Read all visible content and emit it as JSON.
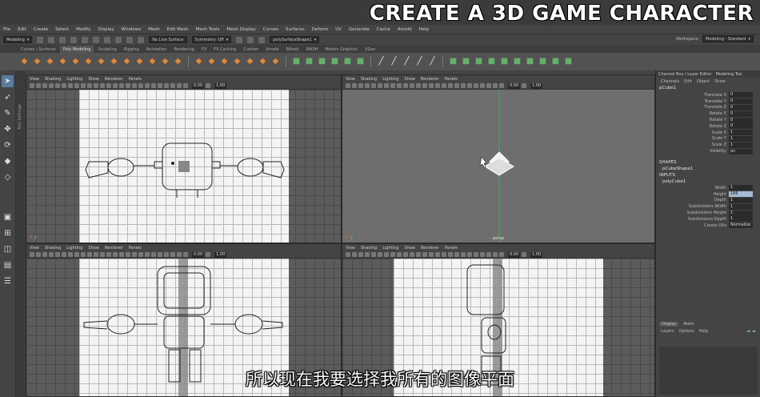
{
  "banner": "CREATE A 3D GAME CHARACTER",
  "subtitle": "所以现在我要选择我所有的图像平面",
  "menubar": [
    "File",
    "Edit",
    "Create",
    "Select",
    "Modify",
    "Display",
    "Windows",
    "Mesh",
    "Edit Mesh",
    "Mesh Tools",
    "Mesh Display",
    "Curves",
    "Surfaces",
    "Deform",
    "UV",
    "Generate",
    "Cache",
    "Arnold",
    "Help"
  ],
  "statusline": {
    "mode": "Modeling",
    "live_surface": "No Live Surface",
    "symmetry": "Symmetry: Off",
    "object": "polySurfaceShape1",
    "workspace_label": "Workspace:",
    "workspace_value": "Modeling - Standard"
  },
  "shelftabs": [
    "Curves / Surfaces",
    "Poly Modeling",
    "Sculpting",
    "Rigging",
    "Animation",
    "Rendering",
    "FX",
    "FX Caching",
    "Custom",
    "Arnold",
    "Bifrost",
    "MASH",
    "Motion Graphics",
    "XGen"
  ],
  "shelftab_active": 1,
  "shelf_groups": [
    {
      "color": "orange",
      "icons": [
        "sphere-icon",
        "cube-icon",
        "cylinder-icon",
        "cone-icon",
        "torus-icon",
        "plane-icon",
        "disc-icon",
        "platonic-icon",
        "pyramid-icon",
        "pipe-icon",
        "helix-icon",
        "gear-icon",
        "soccer-ball-icon"
      ]
    },
    {
      "color": "orange",
      "icons": [
        "svg-icon",
        "text-icon",
        "combine-icon",
        "separate-icon",
        "extract-icon",
        "smooth-icon",
        "boolean-icon"
      ]
    },
    {
      "color": "green",
      "icons": [
        "mirror-icon",
        "bridge-icon",
        "extrude-icon",
        "bevel-icon",
        "fill-hole-icon",
        "merge-icon"
      ]
    },
    {
      "color": "white",
      "icons": [
        "knife-icon",
        "multi-cut-icon",
        "target-weld-icon",
        "connect-icon",
        "edge-loop-icon"
      ]
    },
    {
      "color": "green",
      "icons": [
        "uv-editor-icon",
        "planar-map-icon",
        "auto-map-icon",
        "cylindrical-map-icon",
        "spherical-map-icon",
        "camera-map-icon",
        "layout-uv-icon",
        "unfold-icon",
        "cut-uv-icon",
        "sew-uv-icon"
      ]
    }
  ],
  "viewport_menu": [
    "View",
    "Shading",
    "Lighting",
    "Show",
    "Renderer",
    "Panels"
  ],
  "viewport_field_a": "0.00",
  "viewport_field_b": "1.00",
  "viewports": {
    "top_left": "front",
    "top_right": "persp",
    "bottom_left": "front",
    "bottom_right": "side"
  },
  "persp_label": "persp",
  "toolbox_label": "Tool Settings",
  "channel_box": {
    "tabs": [
      "Channel Box / Layer Editor",
      "Modeling Too"
    ],
    "menu": [
      "Channels",
      "Edit",
      "Object",
      "Show"
    ],
    "object_name": "pCube1",
    "transform_attrs": [
      {
        "label": "Translate X",
        "value": "0"
      },
      {
        "label": "Translate Y",
        "value": "0"
      },
      {
        "label": "Translate Z",
        "value": "0"
      },
      {
        "label": "Rotate X",
        "value": "0"
      },
      {
        "label": "Rotate Y",
        "value": "0"
      },
      {
        "label": "Rotate Z",
        "value": "0"
      },
      {
        "label": "Scale X",
        "value": "1"
      },
      {
        "label": "Scale Y",
        "value": "1"
      },
      {
        "label": "Scale Z",
        "value": "1"
      },
      {
        "label": "Visibility",
        "value": "on"
      }
    ],
    "shapes_header": "SHAPES",
    "shape_name": "pCubeShape1",
    "inputs_header": "INPUTS",
    "input_name": "polyCube1",
    "input_attrs": [
      {
        "label": "Width",
        "value": "1"
      },
      {
        "label": "Height",
        "value": "186",
        "highlight": true
      },
      {
        "label": "Depth",
        "value": "1"
      },
      {
        "label": "Subdivisions Width",
        "value": "1"
      },
      {
        "label": "Subdivisions Height",
        "value": "1"
      },
      {
        "label": "Subdivisions Depth",
        "value": "1"
      },
      {
        "label": "Create UVs",
        "value": "Normalize"
      }
    ]
  },
  "layer_editor": {
    "tabs": [
      "Display",
      "Anim"
    ],
    "menu": [
      "Layers",
      "Options",
      "Help"
    ]
  }
}
